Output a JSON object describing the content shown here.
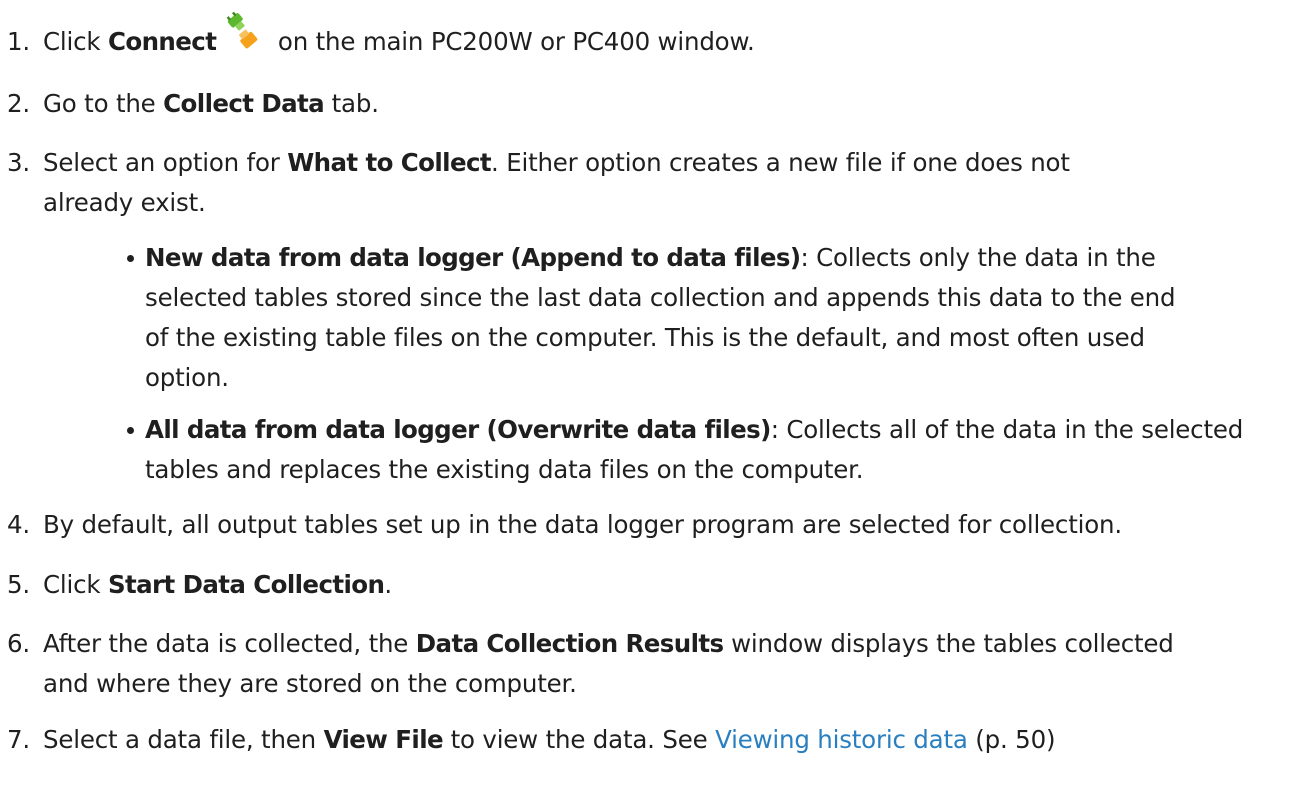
{
  "steps": [
    {
      "num": "1.",
      "pre": "Click ",
      "bold": "Connect",
      "post": " on the main PC200W or PC400 window.",
      "icon": "connect-icon"
    },
    {
      "num": "2.",
      "pre": "Go to the ",
      "bold": "Collect Data",
      "post": " tab."
    },
    {
      "num": "3.",
      "pre": "Select an option for ",
      "bold": "What to Collect",
      "post": ". Either option creates a new file if one does not",
      "line2": "already exist."
    },
    {
      "num": "4.",
      "text": "By default, all output tables set up in the data logger program are selected for collection."
    },
    {
      "num": "5.",
      "pre": "Click ",
      "bold": "Start Data Collection",
      "post": "."
    },
    {
      "num": "6.",
      "pre": "After the data is collected, the ",
      "bold": "Data Collection Results",
      "post": " window displays the tables collected",
      "line2": "and where they are stored on the computer."
    },
    {
      "num": "7.",
      "pre": "Select a data file, then ",
      "bold": "View File",
      "post": " to view the data. See ",
      "link": "Viewing historic data",
      "after": " (p. 50)"
    }
  ],
  "bullets": [
    {
      "bold": "New data from data logger (Append to data files)",
      "lines": [
        ": Collects only the data in the",
        "selected tables stored since the last data collection and appends this data to the end",
        "of the existing table files on the computer. This is the default, and most often used",
        "option."
      ]
    },
    {
      "bold": "All data from data logger (Overwrite data files)",
      "lines": [
        ": Collects all of the data in the selected",
        "tables and replaces the existing data files on the computer."
      ]
    }
  ],
  "colors": {
    "text": "#1f1f1f",
    "link": "#2a7fc0",
    "icon_green": "#5cb82f",
    "icon_orange": "#f5a21a"
  }
}
